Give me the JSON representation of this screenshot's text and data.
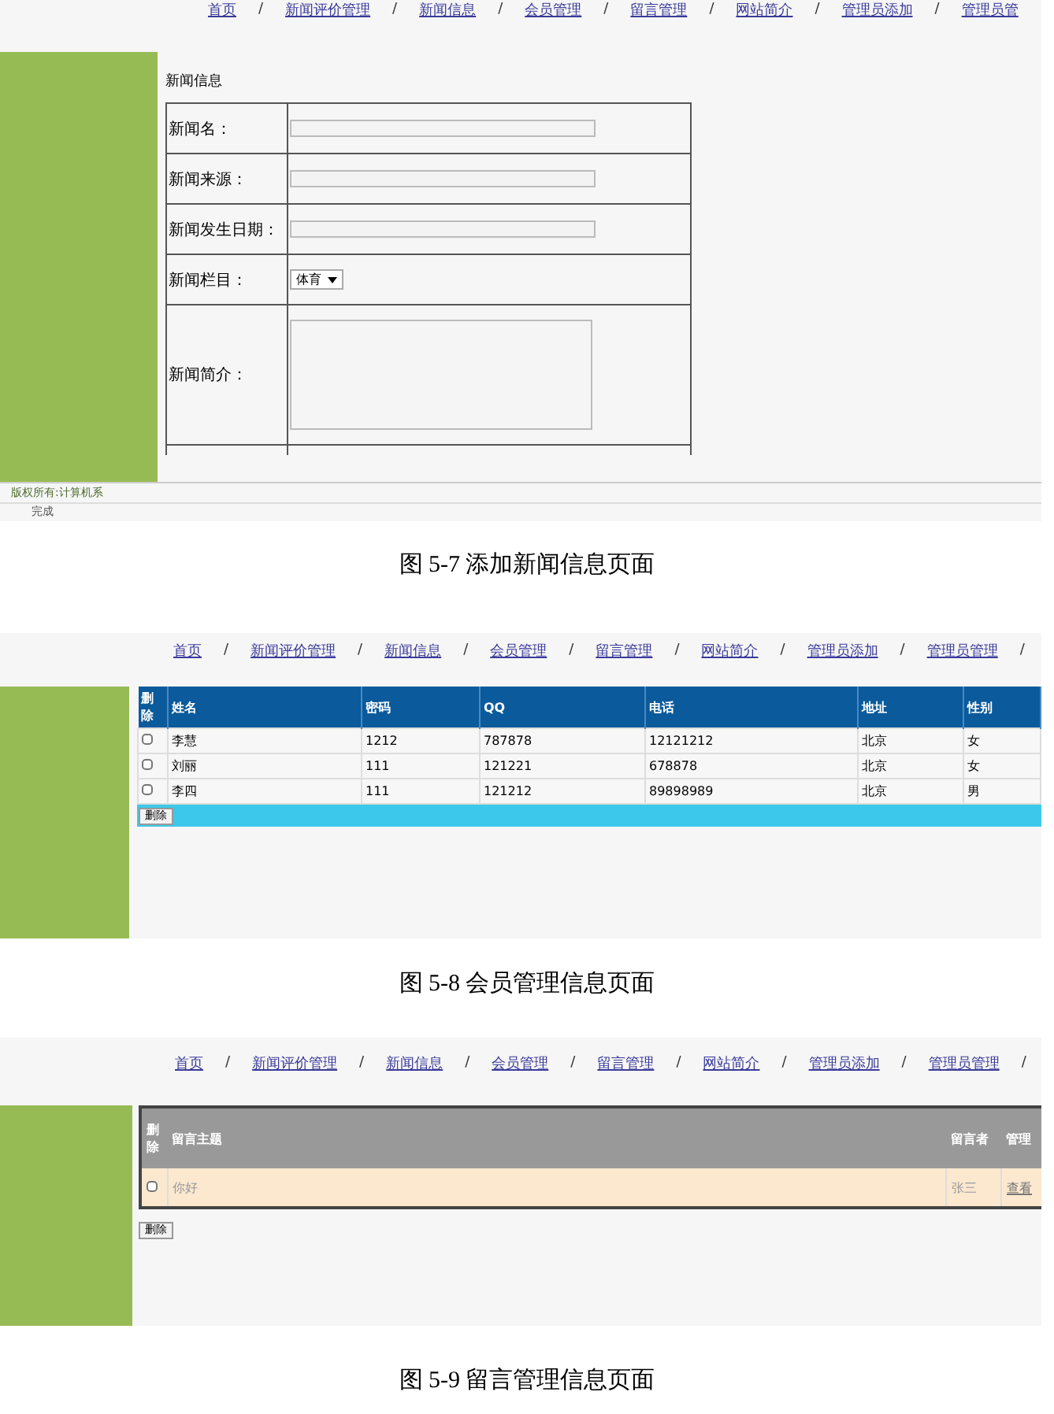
{
  "figures": [
    {
      "kind": "news_form",
      "nav": {
        "items": [
          "首页",
          "新闻评价管理",
          "新闻信息",
          "会员管理",
          "留言管理",
          "网站简介",
          "管理员添加",
          "管理员管"
        ],
        "separator": "/"
      },
      "title": "新闻信息",
      "fields": [
        {
          "label": "新闻名：",
          "kind": "text"
        },
        {
          "label": "新闻来源：",
          "kind": "text"
        },
        {
          "label": "新闻发生日期：",
          "kind": "text"
        },
        {
          "label": "新闻栏目：",
          "kind": "select",
          "value": "体育"
        },
        {
          "label": "新闻简介：",
          "kind": "textarea"
        }
      ],
      "footer": "版权所有:计算机系",
      "status": "完成",
      "caption": "图 5-7 添加新闻信息页面"
    },
    {
      "kind": "members",
      "nav": {
        "items": [
          "首页",
          "新闻评价管理",
          "新闻信息",
          "会员管理",
          "留言管理",
          "网站简介",
          "管理员添加",
          "管理员管理"
        ],
        "separator": "/"
      },
      "checkbox_header": "删除",
      "columns": [
        "姓名",
        "密码",
        "QQ",
        "电话",
        "地址",
        "性别"
      ],
      "rows": [
        {
          "checked": false,
          "cells": [
            "李慧",
            "1212",
            "787878",
            "12121212",
            "北京",
            "女"
          ]
        },
        {
          "checked": false,
          "cells": [
            "刘丽",
            "111",
            "121221",
            "678878",
            "北京",
            "女"
          ]
        },
        {
          "checked": false,
          "cells": [
            "李四",
            "111",
            "121212",
            "89898989",
            "北京",
            "男"
          ]
        }
      ],
      "button": "删除",
      "caption": "图 5-8 会员管理信息页面"
    },
    {
      "kind": "messages",
      "nav": {
        "items": [
          "首页",
          "新闻评价管理",
          "新闻信息",
          "会员管理",
          "留言管理",
          "网站简介",
          "管理员添加",
          "管理员管理"
        ],
        "separator": "/"
      },
      "columns": [
        "删除",
        "留言主题",
        "留言者",
        "管理"
      ],
      "rows": [
        {
          "checked": false,
          "subject": "你好",
          "author": "张三",
          "action": "查看"
        }
      ],
      "button": "删除",
      "caption": "图 5-9 留言管理信息页面"
    }
  ]
}
